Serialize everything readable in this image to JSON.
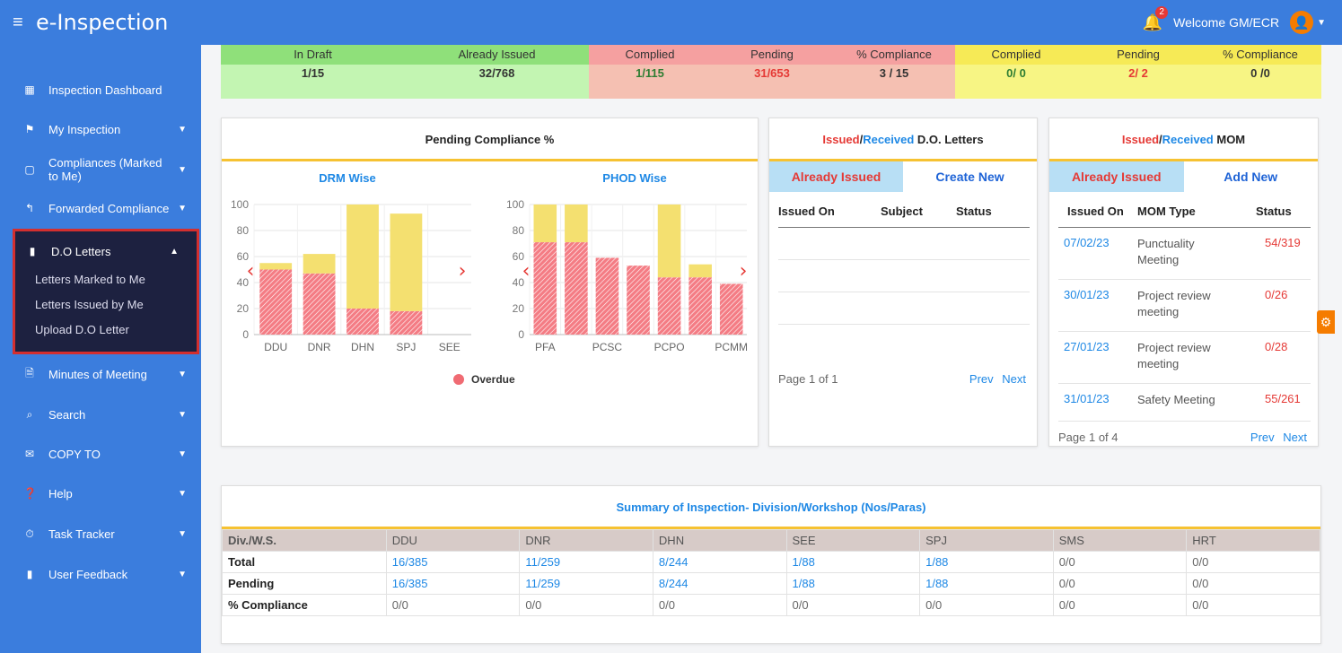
{
  "header": {
    "brand": "e-Inspection",
    "menu_icon": "hamburger-icon",
    "notification_count": "2",
    "welcome": "Welcome GM/ECR"
  },
  "sidebar": {
    "items": [
      {
        "label": "Inspection Dashboard"
      },
      {
        "label": "My Inspection"
      },
      {
        "label": "Compliances (Marked to Me)"
      },
      {
        "label": "Forwarded Compliance"
      },
      {
        "label": "D.O Letters"
      },
      {
        "label": "Minutes of Meeting"
      },
      {
        "label": "Search"
      },
      {
        "label": "COPY TO"
      },
      {
        "label": "Help"
      },
      {
        "label": "Task Tracker"
      },
      {
        "label": "User Feedback"
      }
    ],
    "do_sub": [
      "Letters Marked to Me",
      "Letters Issued by Me",
      "Upload D.O Letter"
    ]
  },
  "stats": {
    "group1": [
      {
        "label": "In Draft",
        "value": "1/15"
      },
      {
        "label": "Already Issued",
        "value": "32/768"
      }
    ],
    "group2": [
      {
        "label": "Complied",
        "value": "1/115"
      },
      {
        "label": "Pending",
        "value": "31/653"
      },
      {
        "label": "% Compliance",
        "value": "3 / 15"
      }
    ],
    "group3": [
      {
        "label": "Complied",
        "value": "0/ 0"
      },
      {
        "label": "Pending",
        "value": "2/ 2"
      },
      {
        "label": "% Compliance",
        "value": "0 /0"
      }
    ]
  },
  "pending_card": {
    "title": "Pending Compliance %",
    "legend": "Overdue"
  },
  "do_card": {
    "title_issued": "Issued",
    "slash": "/",
    "title_received": "Received",
    "title_rest": " D.O. Letters",
    "tab_active": "Already Issued",
    "tab_link": "Create New",
    "cols": [
      "Issued On",
      "Subject",
      "Status"
    ],
    "page": "Page 1 of 1",
    "prev": "Prev",
    "next": "Next"
  },
  "mom_card": {
    "title_issued": "Issued",
    "slash": "/",
    "title_received": "Received",
    "title_rest": " MOM",
    "tab_active": "Already Issued",
    "tab_link": "Add New",
    "cols": [
      "Issued On",
      "MOM Type",
      "Status"
    ],
    "rows": [
      {
        "date": "07/02/23",
        "type": "Punctuality Meeting",
        "status": "54/319"
      },
      {
        "date": "30/01/23",
        "type": "Project review meeting",
        "status": "0/26"
      },
      {
        "date": "27/01/23",
        "type": "Project review meeting",
        "status": "0/28"
      },
      {
        "date": "31/01/23",
        "type": "Safety Meeting",
        "status": "55/261"
      }
    ],
    "page": "Page 1 of 4",
    "prev": "Prev",
    "next": "Next"
  },
  "summary": {
    "title": "Summary of Inspection- Division/Workshop (Nos/Paras)",
    "header_label": "Div./W.S.",
    "divisions": [
      "DDU",
      "DNR",
      "DHN",
      "SEE",
      "SPJ",
      "SMS",
      "HRT"
    ],
    "rows": [
      {
        "label": "Total",
        "values": [
          [
            "16",
            "/385"
          ],
          [
            "11",
            "/259"
          ],
          [
            "8",
            "/244"
          ],
          [
            "1",
            "/88"
          ],
          [
            "1",
            "/88"
          ],
          [
            "0/0",
            ""
          ],
          [
            "0/0",
            ""
          ]
        ]
      },
      {
        "label": "Pending",
        "values": [
          [
            "16",
            "/385"
          ],
          [
            "11",
            "/259"
          ],
          [
            "8",
            "/244"
          ],
          [
            "1",
            "/88"
          ],
          [
            "1",
            "/88"
          ],
          [
            "0/0",
            ""
          ],
          [
            "0/0",
            ""
          ]
        ]
      },
      {
        "label": "% Compliance",
        "values": [
          [
            "0/0",
            ""
          ],
          [
            "0/0",
            ""
          ],
          [
            "0/0",
            ""
          ],
          [
            "0/0",
            ""
          ],
          [
            "0/0",
            ""
          ],
          [
            "0/0",
            ""
          ],
          [
            "0/0",
            ""
          ]
        ]
      }
    ]
  },
  "chart_data": [
    {
      "type": "bar",
      "title": "DRM Wise",
      "categories": [
        "DDU",
        "DNR",
        "DHN",
        "SPJ",
        "SEE"
      ],
      "ylim": [
        0,
        100
      ],
      "yticks": [
        0,
        20,
        40,
        60,
        80,
        100
      ],
      "series": [
        {
          "name": "Overdue",
          "values": [
            50,
            47,
            20,
            18,
            0
          ],
          "color": "#f47c84"
        },
        {
          "values": [
            5,
            15,
            80,
            75,
            0
          ],
          "color": "#f4e070"
        }
      ]
    },
    {
      "type": "bar",
      "title": "PHOD Wise",
      "categories": [
        "PFA",
        "",
        "PCSC",
        "",
        "PCPO",
        "",
        "PCMM"
      ],
      "ylim": [
        0,
        100
      ],
      "yticks": [
        0,
        20,
        40,
        60,
        80,
        100
      ],
      "series": [
        {
          "name": "Overdue",
          "values": [
            71,
            71,
            59,
            53,
            44,
            44,
            39
          ],
          "color": "#f47c84"
        },
        {
          "values": [
            29,
            29,
            0,
            0,
            56,
            10,
            0
          ],
          "color": "#f4e070"
        }
      ]
    }
  ]
}
